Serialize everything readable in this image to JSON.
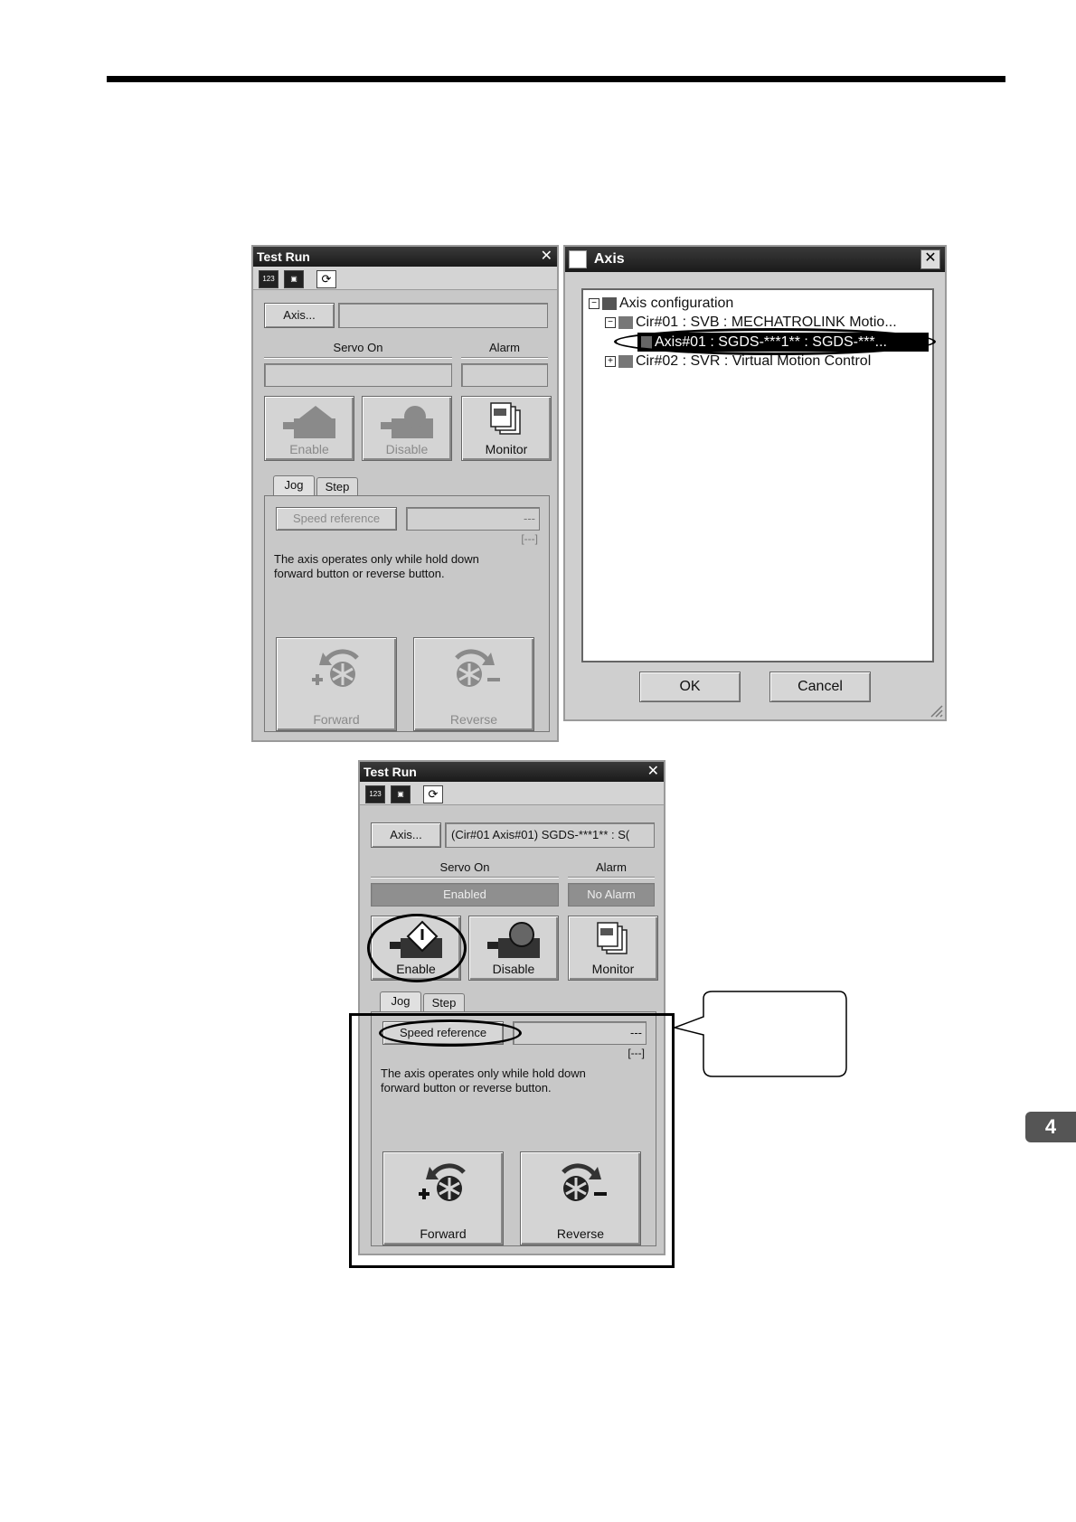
{
  "page": {
    "section_tab": "4"
  },
  "window1": {
    "title": "Test Run",
    "close": "✕",
    "toolbar_icons": [
      "123",
      "▣",
      "⟳"
    ],
    "axis_button": "Axis...",
    "axis_value": "",
    "servo_on_label": "Servo On",
    "alarm_label": "Alarm",
    "servo_status": "",
    "alarm_status": "",
    "enable": "Enable",
    "disable": "Disable",
    "monitor": "Monitor",
    "tabs": [
      "Jog",
      "Step"
    ],
    "speed_reference": "Speed reference",
    "speed_value": "---",
    "speed_unit": "[---]",
    "note": "The axis operates only while hold down forward button or reverse button.",
    "forward": "Forward",
    "reverse": "Reverse"
  },
  "axis_dialog": {
    "title": "Axis",
    "close": "✕",
    "tree": [
      {
        "label": "Axis configuration"
      },
      {
        "label": "Cir#01 : SVB : MECHATROLINK Motio..."
      },
      {
        "label": "Axis#01 : SGDS-***1** : SGDS-***..."
      },
      {
        "label": "Cir#02 : SVR : Virtual Motion Control"
      }
    ],
    "ok": "OK",
    "cancel": "Cancel"
  },
  "window2": {
    "title": "Test Run",
    "close": "✕",
    "toolbar_icons": [
      "123",
      "▣",
      "⟳"
    ],
    "axis_button": "Axis...",
    "axis_value": "(Cir#01 Axis#01) SGDS-***1** : S(",
    "servo_on_label": "Servo On",
    "alarm_label": "Alarm",
    "servo_status": "Enabled",
    "alarm_status": "No Alarm",
    "enable": "Enable",
    "disable": "Disable",
    "monitor": "Monitor",
    "tabs": [
      "Jog",
      "Step"
    ],
    "speed_reference": "Speed reference",
    "speed_value": "---",
    "speed_unit": "[---]",
    "note": "The axis operates only while hold down forward button or reverse button.",
    "forward": "Forward",
    "reverse": "Reverse"
  }
}
